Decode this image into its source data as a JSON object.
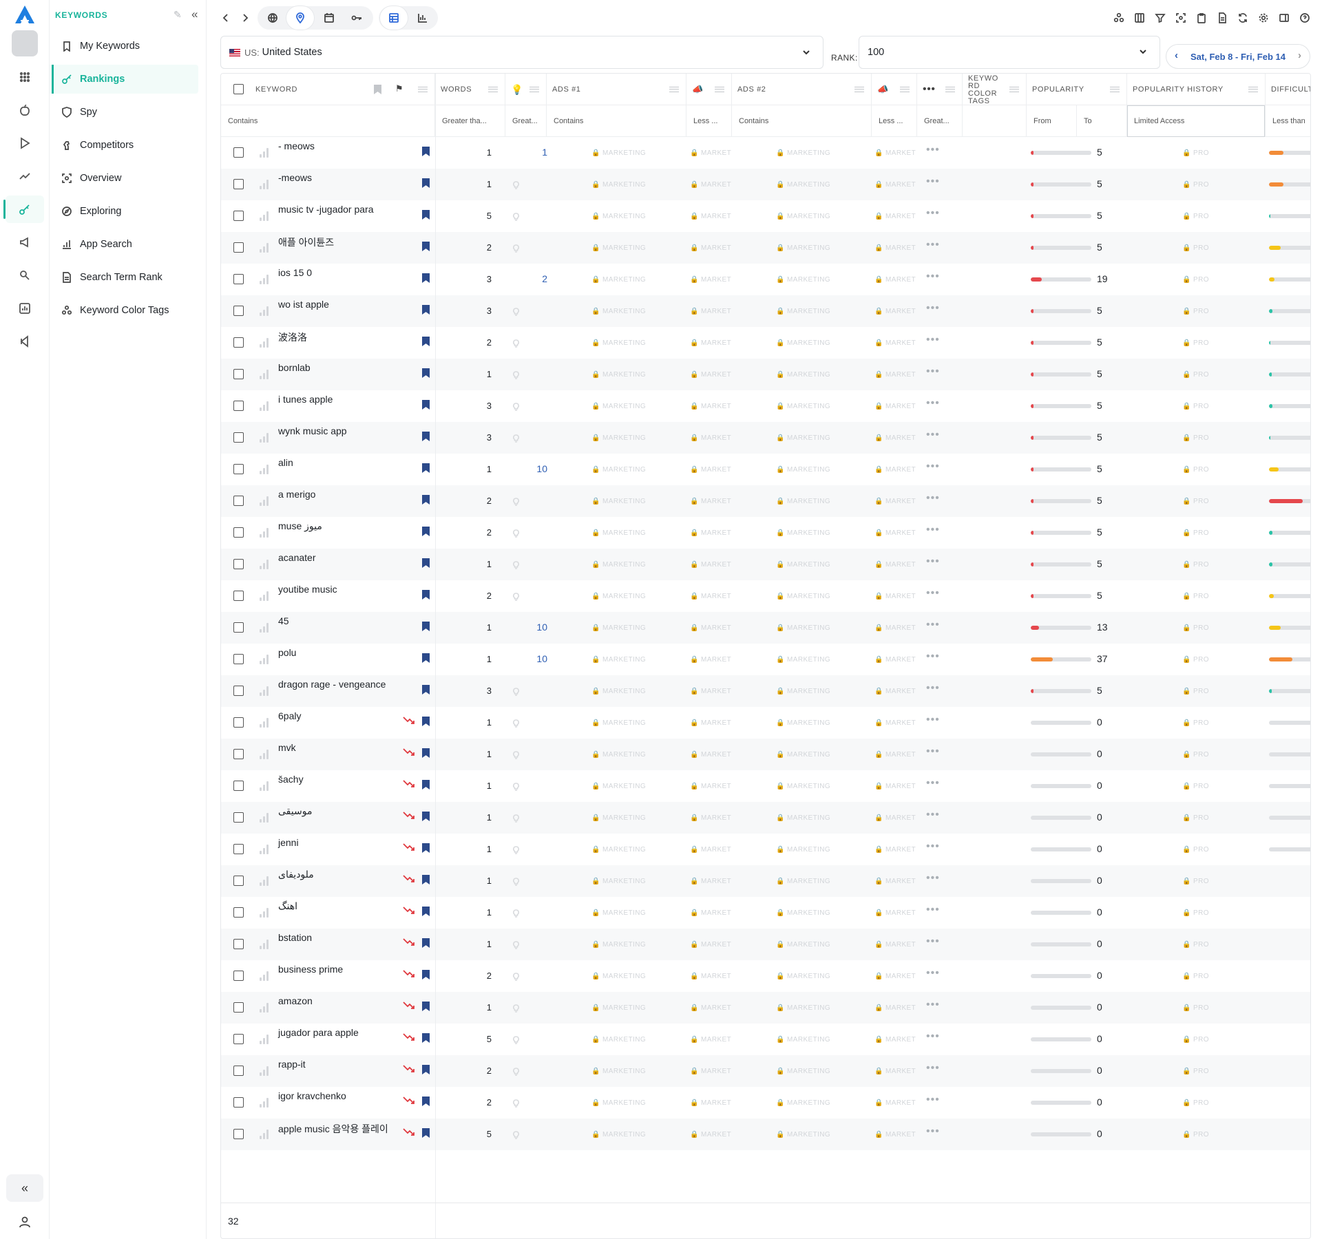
{
  "sidebar": {
    "section_title": "KEYWORDS",
    "items": [
      {
        "label": "My Keywords",
        "icon": "bookmark-icon"
      },
      {
        "label": "Rankings",
        "icon": "key-icon",
        "active": true
      },
      {
        "label": "Spy",
        "icon": "shield-icon"
      },
      {
        "label": "Competitors",
        "icon": "chess-icon"
      },
      {
        "label": "Overview",
        "icon": "overview-icon"
      },
      {
        "label": "Exploring",
        "icon": "compass-icon"
      },
      {
        "label": "App Search",
        "icon": "bar-chart-icon"
      },
      {
        "label": "Search Term Rank",
        "icon": "document-icon"
      },
      {
        "label": "Keyword Color Tags",
        "icon": "dots-cluster-icon"
      }
    ]
  },
  "filters": {
    "country_code": "US:",
    "country_name": "United States",
    "rank_label": "RANK:",
    "rank_value": "100",
    "date_range": "Sat, Feb 8 - Fri, Feb 14"
  },
  "columns": {
    "keyword": "KEYWORD",
    "words": "WORDS",
    "ads1": "ADS #1",
    "ads2": "ADS #2",
    "color_tags": "KEYWO RD COLOR TAGS",
    "popularity": "POPULARITY",
    "popularity_history": "POPULARITY HISTORY",
    "difficulty": "DIFFICULT"
  },
  "filter_row": {
    "keyword": "Contains",
    "words": "Greater tha...",
    "rank": "Great...",
    "ads1": "Contains",
    "ads1_less": "Less ...",
    "ads2": "Contains",
    "ads2_less": "Less ...",
    "dots": "Great...",
    "pop_from": "From",
    "pop_to": "To",
    "history": "Limited Access",
    "difficulty": "Less than"
  },
  "locked_labels": {
    "marketing": "MARKETING",
    "market": "MARKET",
    "pro": "PRO"
  },
  "colors": {
    "accent": "#19b49b",
    "rank_link": "#2f5fb3",
    "bookmark": "#2c4a8a",
    "red": "#e5484d",
    "orange": "#f28c38",
    "yellow": "#f5c518",
    "teal": "#2bc3a7"
  },
  "rows": [
    {
      "keyword": "- meows",
      "words": "1",
      "rank": "1",
      "popularity": 5,
      "difficulty": 30,
      "diff_color": "orange",
      "trend": false
    },
    {
      "keyword": "-meows",
      "words": "1",
      "rank": "",
      "popularity": 5,
      "difficulty": 30,
      "diff_color": "orange",
      "trend": false
    },
    {
      "keyword": "music tv -jugador para",
      "words": "5",
      "rank": "",
      "popularity": 5,
      "difficulty": 3,
      "diff_color": "teal",
      "trend": false
    },
    {
      "keyword": "애플 아이튠즈",
      "words": "2",
      "rank": "",
      "popularity": 5,
      "difficulty": 24,
      "diff_color": "yellow",
      "trend": false
    },
    {
      "keyword": "ios 15 0",
      "words": "3",
      "rank": "2",
      "popularity": 19,
      "difficulty": 12,
      "diff_color": "yellow",
      "trend": false
    },
    {
      "keyword": "wo ist apple",
      "words": "3",
      "rank": "",
      "popularity": 5,
      "difficulty": 7,
      "diff_color": "teal",
      "trend": false
    },
    {
      "keyword": "波洛洛",
      "words": "2",
      "rank": "",
      "popularity": 5,
      "difficulty": 3,
      "diff_color": "teal",
      "trend": false
    },
    {
      "keyword": "bornlab",
      "words": "1",
      "rank": "",
      "popularity": 5,
      "difficulty": 5,
      "diff_color": "teal",
      "trend": false
    },
    {
      "keyword": "i tunes apple",
      "words": "3",
      "rank": "",
      "popularity": 5,
      "difficulty": 7,
      "diff_color": "teal",
      "trend": false
    },
    {
      "keyword": "wynk music app",
      "words": "3",
      "rank": "",
      "popularity": 5,
      "difficulty": 3,
      "diff_color": "teal",
      "trend": false
    },
    {
      "keyword": "alin",
      "words": "1",
      "rank": "10",
      "popularity": 5,
      "difficulty": 20,
      "diff_color": "yellow",
      "trend": false
    },
    {
      "keyword": "a merigo",
      "words": "2",
      "rank": "",
      "popularity": 5,
      "difficulty": 70,
      "diff_color": "red",
      "trend": false
    },
    {
      "keyword": "muse  ميوز",
      "words": "2",
      "rank": "",
      "popularity": 5,
      "difficulty": 7,
      "diff_color": "teal",
      "trend": false
    },
    {
      "keyword": "acanater",
      "words": "1",
      "rank": "",
      "popularity": 5,
      "difficulty": 7,
      "diff_color": "teal",
      "trend": false
    },
    {
      "keyword": "youtibe music",
      "words": "2",
      "rank": "",
      "popularity": 5,
      "difficulty": 10,
      "diff_color": "yellow",
      "trend": false
    },
    {
      "keyword": "45",
      "words": "1",
      "rank": "10",
      "popularity": 13,
      "difficulty": 24,
      "diff_color": "yellow",
      "trend": false
    },
    {
      "keyword": "polu",
      "words": "1",
      "rank": "10",
      "popularity": 37,
      "difficulty": 48,
      "diff_color": "orange",
      "trend": false
    },
    {
      "keyword": "dragon rage - vengeance",
      "words": "3",
      "rank": "",
      "popularity": 5,
      "difficulty": 5,
      "diff_color": "teal",
      "trend": false
    },
    {
      "keyword": "6paly",
      "words": "1",
      "rank": "",
      "popularity": 0,
      "difficulty": 0,
      "diff_color": "",
      "trend": true
    },
    {
      "keyword": "mvk",
      "words": "1",
      "rank": "",
      "popularity": 0,
      "difficulty": 0,
      "diff_color": "",
      "trend": true
    },
    {
      "keyword": "šachy",
      "words": "1",
      "rank": "",
      "popularity": 0,
      "difficulty": 0,
      "diff_color": "",
      "trend": true
    },
    {
      "keyword": "موسيقى",
      "words": "1",
      "rank": "",
      "popularity": 0,
      "difficulty": 0,
      "diff_color": "",
      "trend": true
    },
    {
      "keyword": "jenni",
      "words": "1",
      "rank": "",
      "popularity": 0,
      "difficulty": 0,
      "diff_color": "",
      "trend": true
    },
    {
      "keyword": "ملودیفای",
      "words": "1",
      "rank": "",
      "popularity": 0,
      "difficulty": -1,
      "diff_color": "",
      "trend": true
    },
    {
      "keyword": "اهنگ",
      "words": "1",
      "rank": "",
      "popularity": 0,
      "difficulty": -1,
      "diff_color": "",
      "trend": true
    },
    {
      "keyword": "bstation",
      "words": "1",
      "rank": "",
      "popularity": 0,
      "difficulty": -1,
      "diff_color": "",
      "trend": true
    },
    {
      "keyword": "business prime",
      "words": "2",
      "rank": "",
      "popularity": 0,
      "difficulty": -1,
      "diff_color": "",
      "trend": true
    },
    {
      "keyword": "amazon",
      "words": "1",
      "rank": "",
      "popularity": 0,
      "difficulty": -1,
      "diff_color": "",
      "trend": true
    },
    {
      "keyword": "jugador para apple",
      "words": "5",
      "rank": "",
      "popularity": 0,
      "difficulty": -1,
      "diff_color": "",
      "trend": true
    },
    {
      "keyword": "rapp-it",
      "words": "2",
      "rank": "",
      "popularity": 0,
      "difficulty": -1,
      "diff_color": "",
      "trend": true
    },
    {
      "keyword": "igor kravchenko",
      "words": "2",
      "rank": "",
      "popularity": 0,
      "difficulty": -1,
      "diff_color": "",
      "trend": true
    },
    {
      "keyword": "apple music 음악용 플레이",
      "words": "5",
      "rank": "",
      "popularity": 0,
      "difficulty": -1,
      "diff_color": "",
      "trend": true
    }
  ],
  "footer": {
    "count": "32"
  }
}
